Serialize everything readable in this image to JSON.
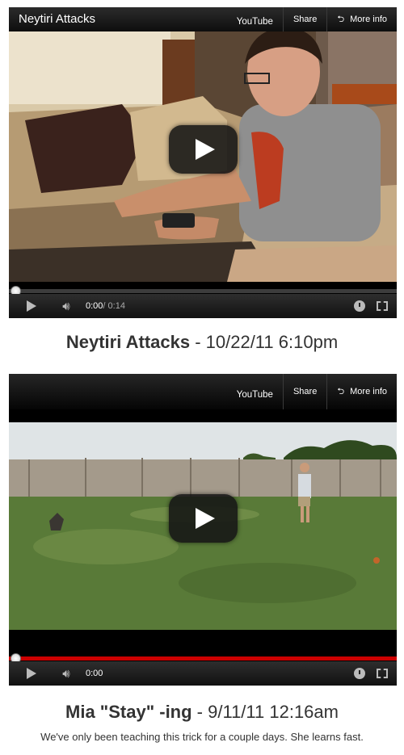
{
  "videos": [
    {
      "title": "Neytiri Attacks",
      "top_buttons": {
        "youtube": "YouTube",
        "share": "Share",
        "more_info": "More info"
      },
      "time_current": "0:00",
      "time_duration": " / 0:14",
      "progress": 0.0,
      "caption_title": "Neytiri Attacks",
      "caption_date": " - 10/22/11 6:10pm"
    },
    {
      "title": "",
      "top_buttons": {
        "youtube": "YouTube",
        "share": "Share",
        "more_info": "More info"
      },
      "time_current": "0:00",
      "time_duration": "",
      "progress": 0.0,
      "caption_title": "Mia \"Stay\" -ing",
      "caption_date": " - 9/11/11 12:16am",
      "description": "We've only been teaching this trick for a couple days. She learns fast."
    }
  ],
  "icons": {
    "play": "play-icon",
    "volume": "volume-icon",
    "watch_later": "clock-icon",
    "fullscreen": "fullscreen-icon",
    "more_info": "more-info-icon"
  },
  "colors": {
    "progress_played": "#cc0000",
    "player_bg": "#000000",
    "caption_text": "#333333"
  }
}
